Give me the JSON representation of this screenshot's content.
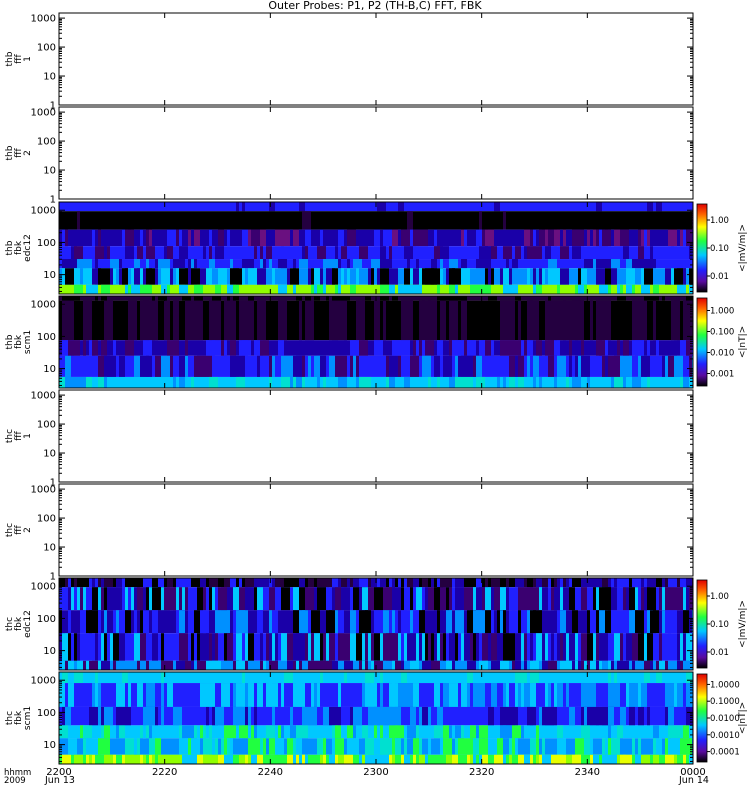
{
  "title": "Outer Probes: P1, P2 (TH-B,C) FFT, FBK",
  "chart_data": [
    {
      "type": "heatmap",
      "panel_id": "thb_fff_1",
      "ylabel_lines": [
        "thb",
        "fff",
        "1"
      ],
      "y_ticks": [
        "1",
        "10",
        "100",
        "1000"
      ],
      "log_scale": true,
      "ylim": [
        1,
        1500
      ],
      "has_data": false
    },
    {
      "type": "heatmap",
      "panel_id": "thb_fff_2",
      "ylabel_lines": [
        "thb",
        "fff",
        "2"
      ],
      "y_ticks": [
        "1",
        "10",
        "100",
        "1000"
      ],
      "log_scale": true,
      "ylim": [
        1,
        1500
      ],
      "has_data": false
    },
    {
      "type": "heatmap",
      "panel_id": "thb_fbk_edc12",
      "ylabel_lines": [
        "thb",
        "fbk",
        "edc12"
      ],
      "y_ticks": [
        "10",
        "100",
        "1000"
      ],
      "log_scale": true,
      "ylim": [
        2.5,
        1800
      ],
      "has_data": true,
      "colorbar_ticks": [
        "1.00",
        "0.10",
        "0.01"
      ],
      "colorbar_label": "<|mV/m|>"
    },
    {
      "type": "heatmap",
      "panel_id": "thb_fbk_scm1",
      "ylabel_lines": [
        "thb",
        "fbk",
        "scm1"
      ],
      "y_ticks": [
        "10",
        "100",
        "1000"
      ],
      "log_scale": true,
      "ylim": [
        2.5,
        1800
      ],
      "has_data": true,
      "colorbar_ticks": [
        "1.000",
        "0.100",
        "0.010",
        "0.001"
      ],
      "colorbar_label": "<|nT|>"
    },
    {
      "type": "heatmap",
      "panel_id": "thc_fff_1",
      "ylabel_lines": [
        "thc",
        "fff",
        "1"
      ],
      "y_ticks": [
        "1",
        "10",
        "100",
        "1000"
      ],
      "log_scale": true,
      "ylim": [
        1,
        1500
      ],
      "has_data": false
    },
    {
      "type": "heatmap",
      "panel_id": "thc_fff_2",
      "ylabel_lines": [
        "thc",
        "fff",
        "2"
      ],
      "y_ticks": [
        "1",
        "10",
        "100",
        "1000"
      ],
      "log_scale": true,
      "ylim": [
        1,
        1500
      ],
      "has_data": false
    },
    {
      "type": "heatmap",
      "panel_id": "thc_fbk_edc12",
      "ylabel_lines": [
        "thc",
        "fbk",
        "edc12"
      ],
      "y_ticks": [
        "10",
        "100",
        "1000"
      ],
      "log_scale": true,
      "ylim": [
        2.5,
        1800
      ],
      "has_data": true,
      "colorbar_ticks": [
        "1.00",
        "0.10",
        "0.01"
      ],
      "colorbar_label": "<|mV/m|>"
    },
    {
      "type": "heatmap",
      "panel_id": "thc_fbk_scm1",
      "ylabel_lines": [
        "thc",
        "fbk",
        "scm1"
      ],
      "y_ticks": [
        "10",
        "100",
        "1000"
      ],
      "log_scale": true,
      "ylim": [
        2.5,
        1800
      ],
      "has_data": true,
      "colorbar_ticks": [
        "1.0000",
        "0.1000",
        "0.0100",
        "0.0010",
        "0.0001"
      ],
      "colorbar_label": "<|nT|>"
    }
  ],
  "time_axis": {
    "label_lines": [
      "hhmm",
      "2009"
    ],
    "ticks": [
      "2200",
      "2220",
      "2240",
      "2300",
      "2320",
      "2340",
      "0000"
    ],
    "start_date": "Jun 13",
    "end_date": "Jun 14"
  }
}
